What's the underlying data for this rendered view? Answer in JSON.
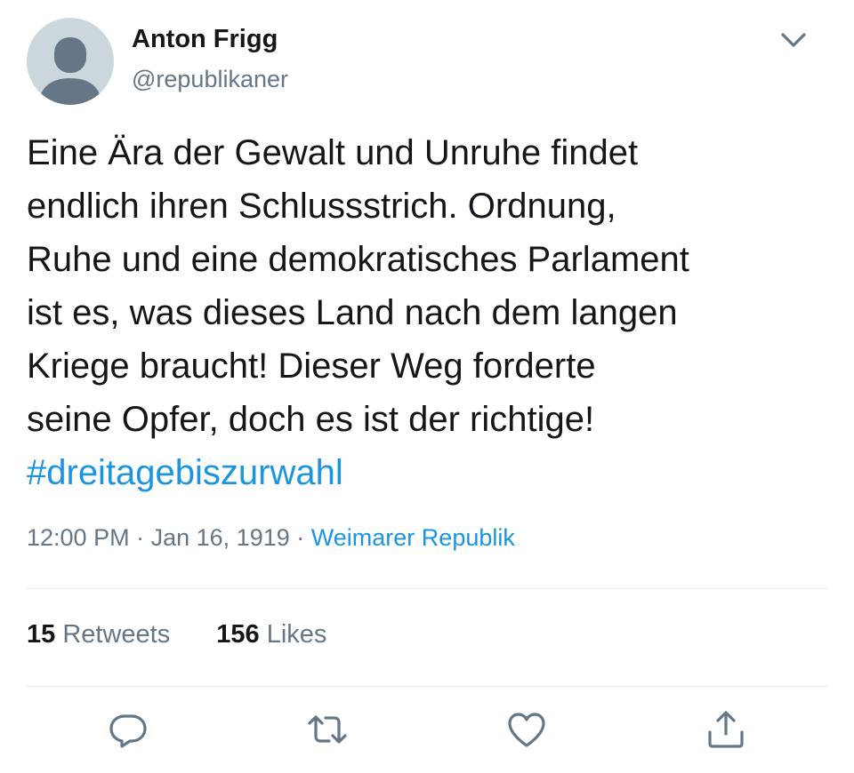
{
  "author": {
    "display_name": "Anton Frigg",
    "handle": "@republikaner"
  },
  "tweet": {
    "text_lines": [
      "Eine Ära der Gewalt und Unruhe findet",
      "endlich ihren Schlussstrich. Ordnung,",
      "Ruhe und eine demokratisches Parlament",
      "ist es, was dieses Land nach dem langen",
      "Kriege braucht! Dieser Weg forderte",
      "seine Opfer, doch es ist der richtige!"
    ],
    "hashtag": "#dreitagebiszurwahl",
    "time": "12:00 PM",
    "date": "Jan 16, 1919",
    "separator": "·",
    "source": "Weimarer Republik"
  },
  "stats": {
    "retweets_count": "15",
    "retweets_label": "Retweets",
    "likes_count": "156",
    "likes_label": "Likes"
  },
  "icons": {
    "chevron": "chevron-down-icon",
    "reply": "reply-icon",
    "retweet": "retweet-icon",
    "like": "heart-icon",
    "share": "share-icon"
  },
  "colors": {
    "text": "#14171a",
    "secondary": "#657786",
    "link": "#1b95e0",
    "divider": "#e6ecf0",
    "avatar_bg": "#ccd6dd",
    "avatar_fg": "#657786"
  }
}
